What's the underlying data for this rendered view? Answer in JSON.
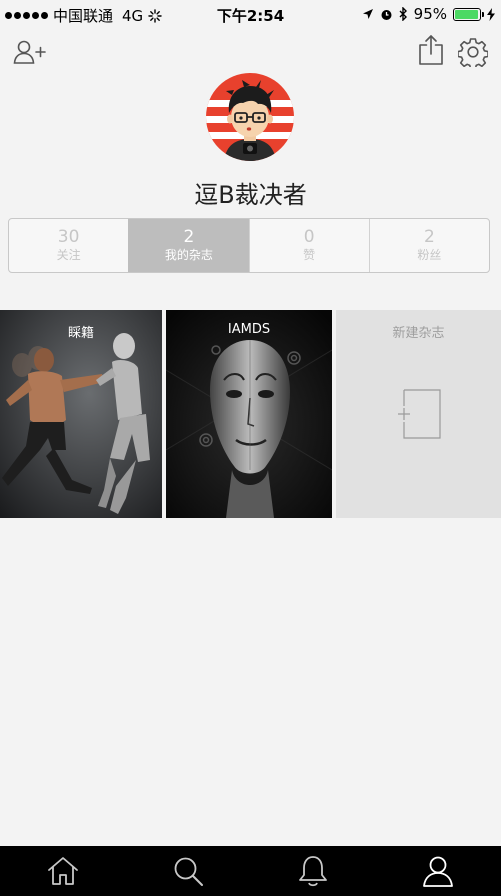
{
  "status_bar": {
    "carrier": "中国联通",
    "network": "4G",
    "time": "下午2:54",
    "battery_percent": "95%",
    "battery_level": 0.95
  },
  "header": {
    "add_friend_icon": "person-add-icon",
    "share_icon": "share-icon",
    "settings_icon": "gear-icon"
  },
  "profile": {
    "username": "逗B裁决者"
  },
  "stats": [
    {
      "value": "30",
      "label": "关注",
      "active": false
    },
    {
      "value": "2",
      "label": "我的杂志",
      "active": true
    },
    {
      "value": "0",
      "label": "赞",
      "active": false
    },
    {
      "value": "2",
      "label": "粉丝",
      "active": false
    }
  ],
  "magazines": [
    {
      "title": "睬籍"
    },
    {
      "title": "IAMDS"
    },
    {
      "title": "新建杂志"
    }
  ],
  "tabs": [
    {
      "name": "home",
      "icon": "home-icon"
    },
    {
      "name": "search",
      "icon": "search-icon"
    },
    {
      "name": "notifications",
      "icon": "bell-icon"
    },
    {
      "name": "profile",
      "icon": "person-icon"
    }
  ],
  "colors": {
    "background": "#f3f3f3",
    "stat_active": "#bdbdbd",
    "tab_bar": "#000000",
    "battery": "#4cd964",
    "avatar_red": "#e8412d"
  }
}
